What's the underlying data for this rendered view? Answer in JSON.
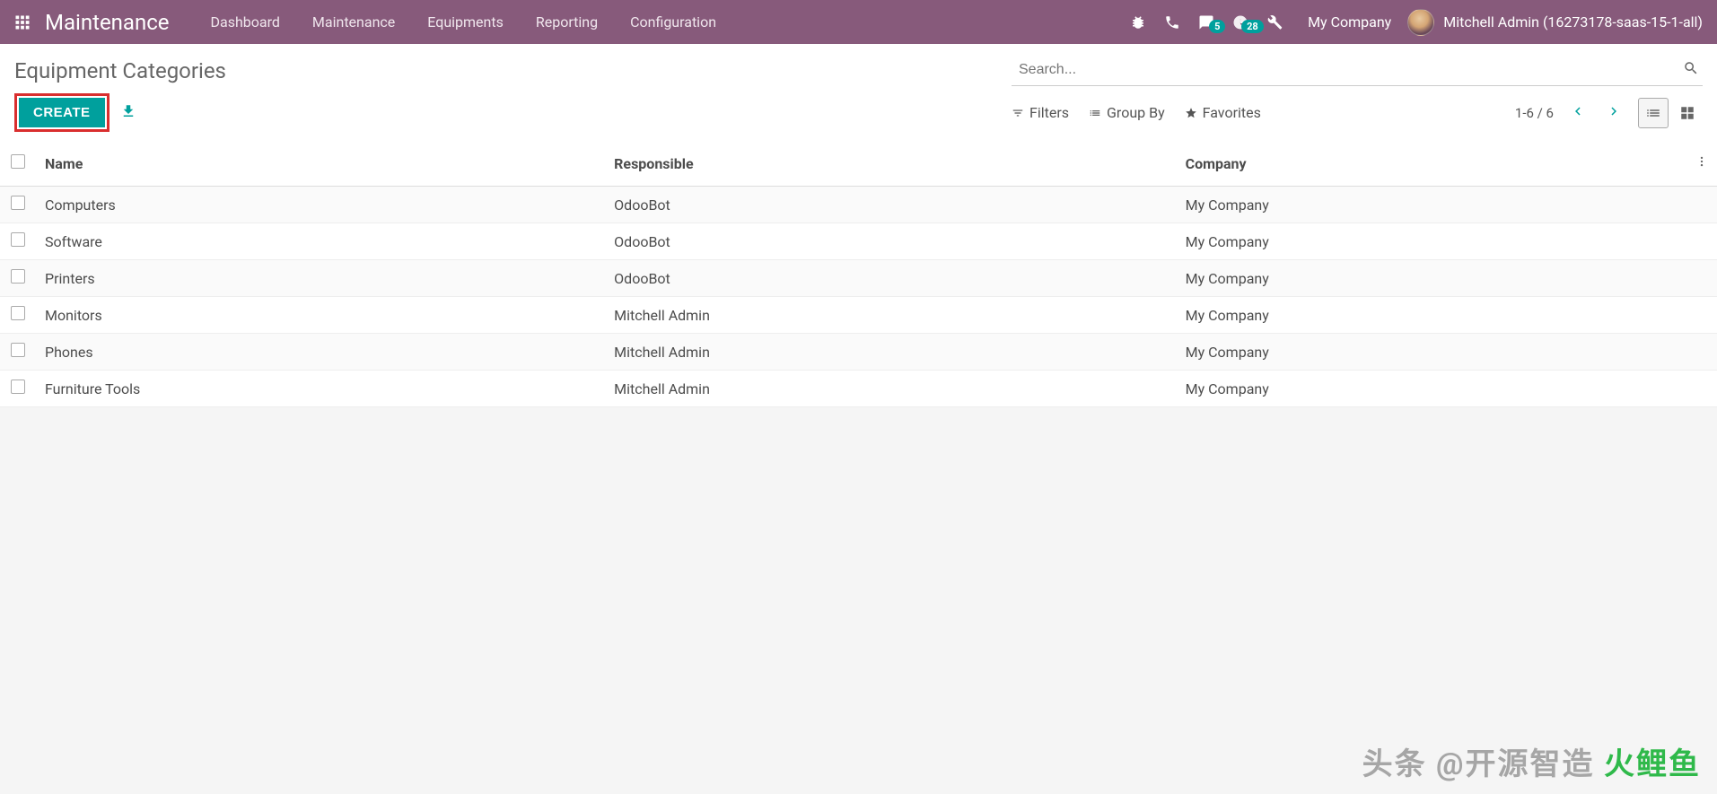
{
  "navbar": {
    "app_name": "Maintenance",
    "menu": [
      "Dashboard",
      "Maintenance",
      "Equipments",
      "Reporting",
      "Configuration"
    ],
    "messaging_badge": "5",
    "activity_badge": "28",
    "company": "My Company",
    "user": "Mitchell Admin (16273178-saas-15-1-all)"
  },
  "page": {
    "title": "Equipment Categories",
    "search_placeholder": "Search...",
    "create_label": "CREATE",
    "filters_label": "Filters",
    "groupby_label": "Group By",
    "favorites_label": "Favorites",
    "pager": "1-6 / 6"
  },
  "table": {
    "columns": [
      "Name",
      "Responsible",
      "Company"
    ],
    "rows": [
      {
        "name": "Computers",
        "responsible": "OdooBot",
        "company": "My Company"
      },
      {
        "name": "Software",
        "responsible": "OdooBot",
        "company": "My Company"
      },
      {
        "name": "Printers",
        "responsible": "OdooBot",
        "company": "My Company"
      },
      {
        "name": "Monitors",
        "responsible": "Mitchell Admin",
        "company": "My Company"
      },
      {
        "name": "Phones",
        "responsible": "Mitchell Admin",
        "company": "My Company"
      },
      {
        "name": "Furniture Tools",
        "responsible": "Mitchell Admin",
        "company": "My Company"
      }
    ]
  },
  "watermark": "头条 @开源智造"
}
